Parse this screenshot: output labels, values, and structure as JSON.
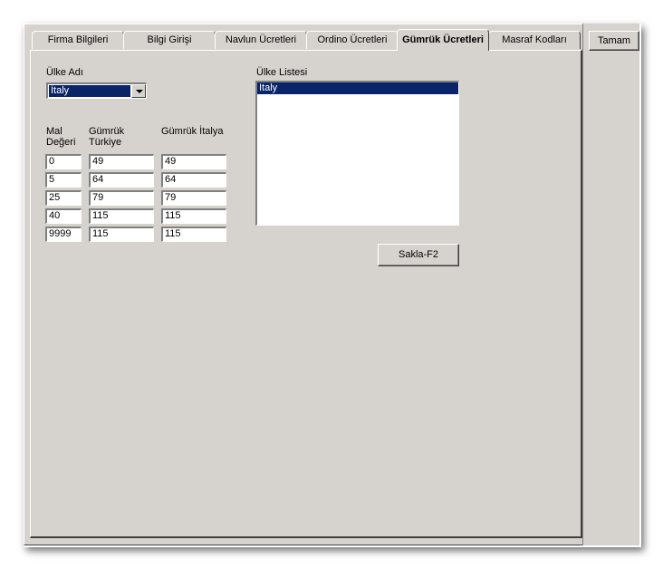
{
  "tabs": [
    {
      "label": "Firma Bilgileri",
      "active": false
    },
    {
      "label": "Bilgi Girişi",
      "active": false
    },
    {
      "label": "Navlun Ücretleri",
      "active": false
    },
    {
      "label": "Ordino Ücretleri",
      "active": false
    },
    {
      "label": "Gümrük Ücretleri",
      "active": true
    },
    {
      "label": "Masraf Kodları",
      "active": false
    }
  ],
  "ok_button": "Tamam",
  "country": {
    "label": "Ülke Adı",
    "selected": "İtaly"
  },
  "country_list": {
    "label": "Ülke Listesi",
    "items": [
      "Italy"
    ]
  },
  "table": {
    "headers": {
      "mal": "Mal\nDeğeri",
      "tr": "Gümrük\nTürkiye",
      "it": "Gümrük İtalya"
    },
    "rows": [
      {
        "mal": "0",
        "tr": "49",
        "it": "49"
      },
      {
        "mal": "5",
        "tr": "64",
        "it": "64"
      },
      {
        "mal": "25",
        "tr": "79",
        "it": "79"
      },
      {
        "mal": "40",
        "tr": "115",
        "it": "115"
      },
      {
        "mal": "9999",
        "tr": "115",
        "it": "115"
      }
    ]
  },
  "save_button": "Sakla-F2"
}
